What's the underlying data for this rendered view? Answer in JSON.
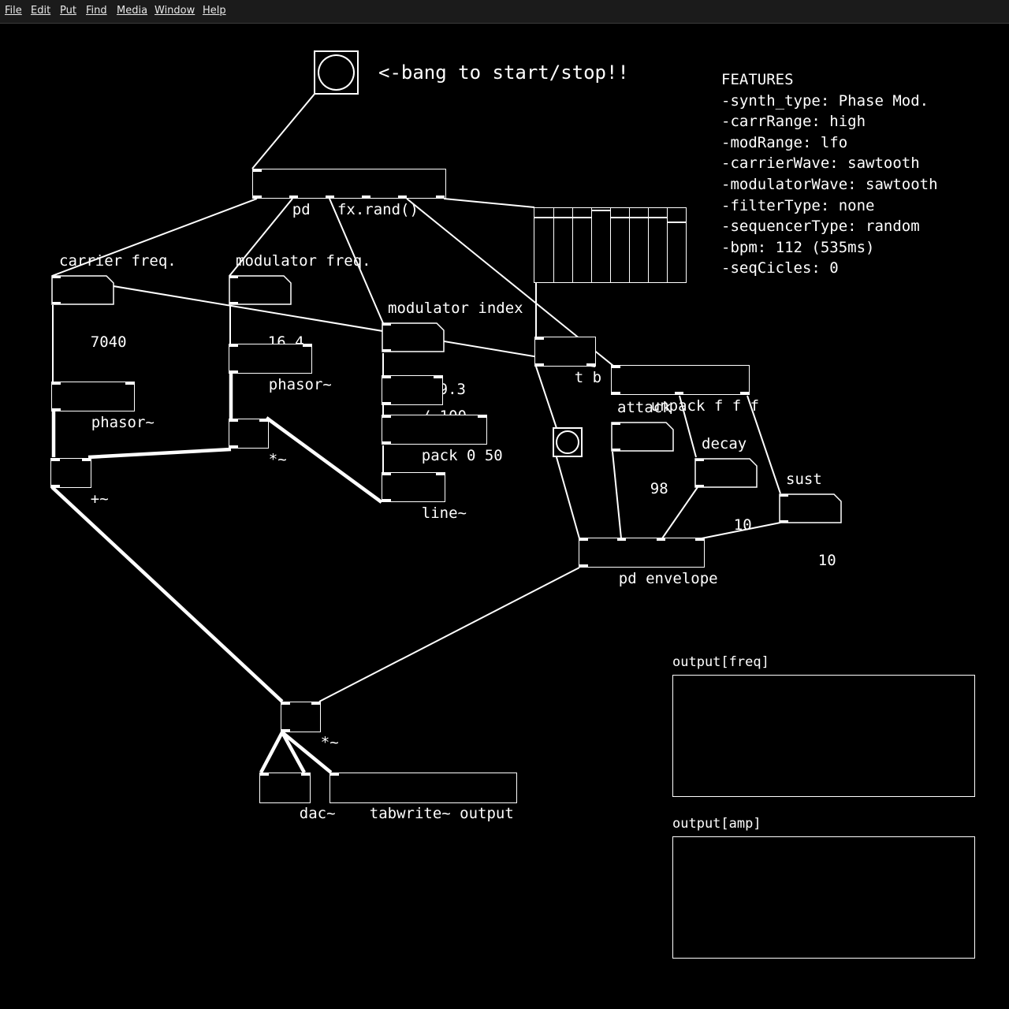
{
  "menu": [
    "File",
    "Edit",
    "Put",
    "Find",
    "Media",
    "Window",
    "Help"
  ],
  "patch": {
    "bang_comment": "<-bang to start/stop!!",
    "fx_rand": "pd   fx.rand()",
    "carrier_freq_label": "carrier freq.",
    "carrier_freq_value": "7040",
    "modulator_freq_label": "modulator freq.",
    "modulator_freq_value": "16.4",
    "modulator_index_label": "modulator index",
    "modulator_index_value": "659.3",
    "phasor_mod": "phasor~",
    "phasor_car": "phasor~",
    "div100": "/ 100",
    "pack": "pack 0 50",
    "line": "line~",
    "mult_mod": "*~",
    "add_car": "+~",
    "tbf": "t b f",
    "unpack": "unpack f f f",
    "attack_label": "attack",
    "attack_value": "98",
    "decay_label": "decay",
    "decay_value": "10",
    "sust_label": "sust",
    "sust_value": "10",
    "envelope": "pd envelope",
    "mult_out": "*~",
    "dac": "dac~",
    "tabwrite": "tabwrite~ output"
  },
  "features": [
    "FEATURES",
    "-synth_type: Phase Mod.",
    "-carrRange: high",
    "-modRange: lfo",
    "-carrierWave: sawtooth",
    "-modulatorWave: sawtooth",
    "-filterType: none",
    "-sequencerType: random",
    "-bpm: 112 (535ms)",
    "-seqCicles: 0"
  ],
  "sequencer_steps": [
    0.12,
    0.12,
    0.12,
    0.02,
    0.12,
    0.12,
    0.12,
    0.18
  ],
  "graphs": {
    "freq_label": "output[freq]",
    "amp_label": "output[amp]"
  }
}
